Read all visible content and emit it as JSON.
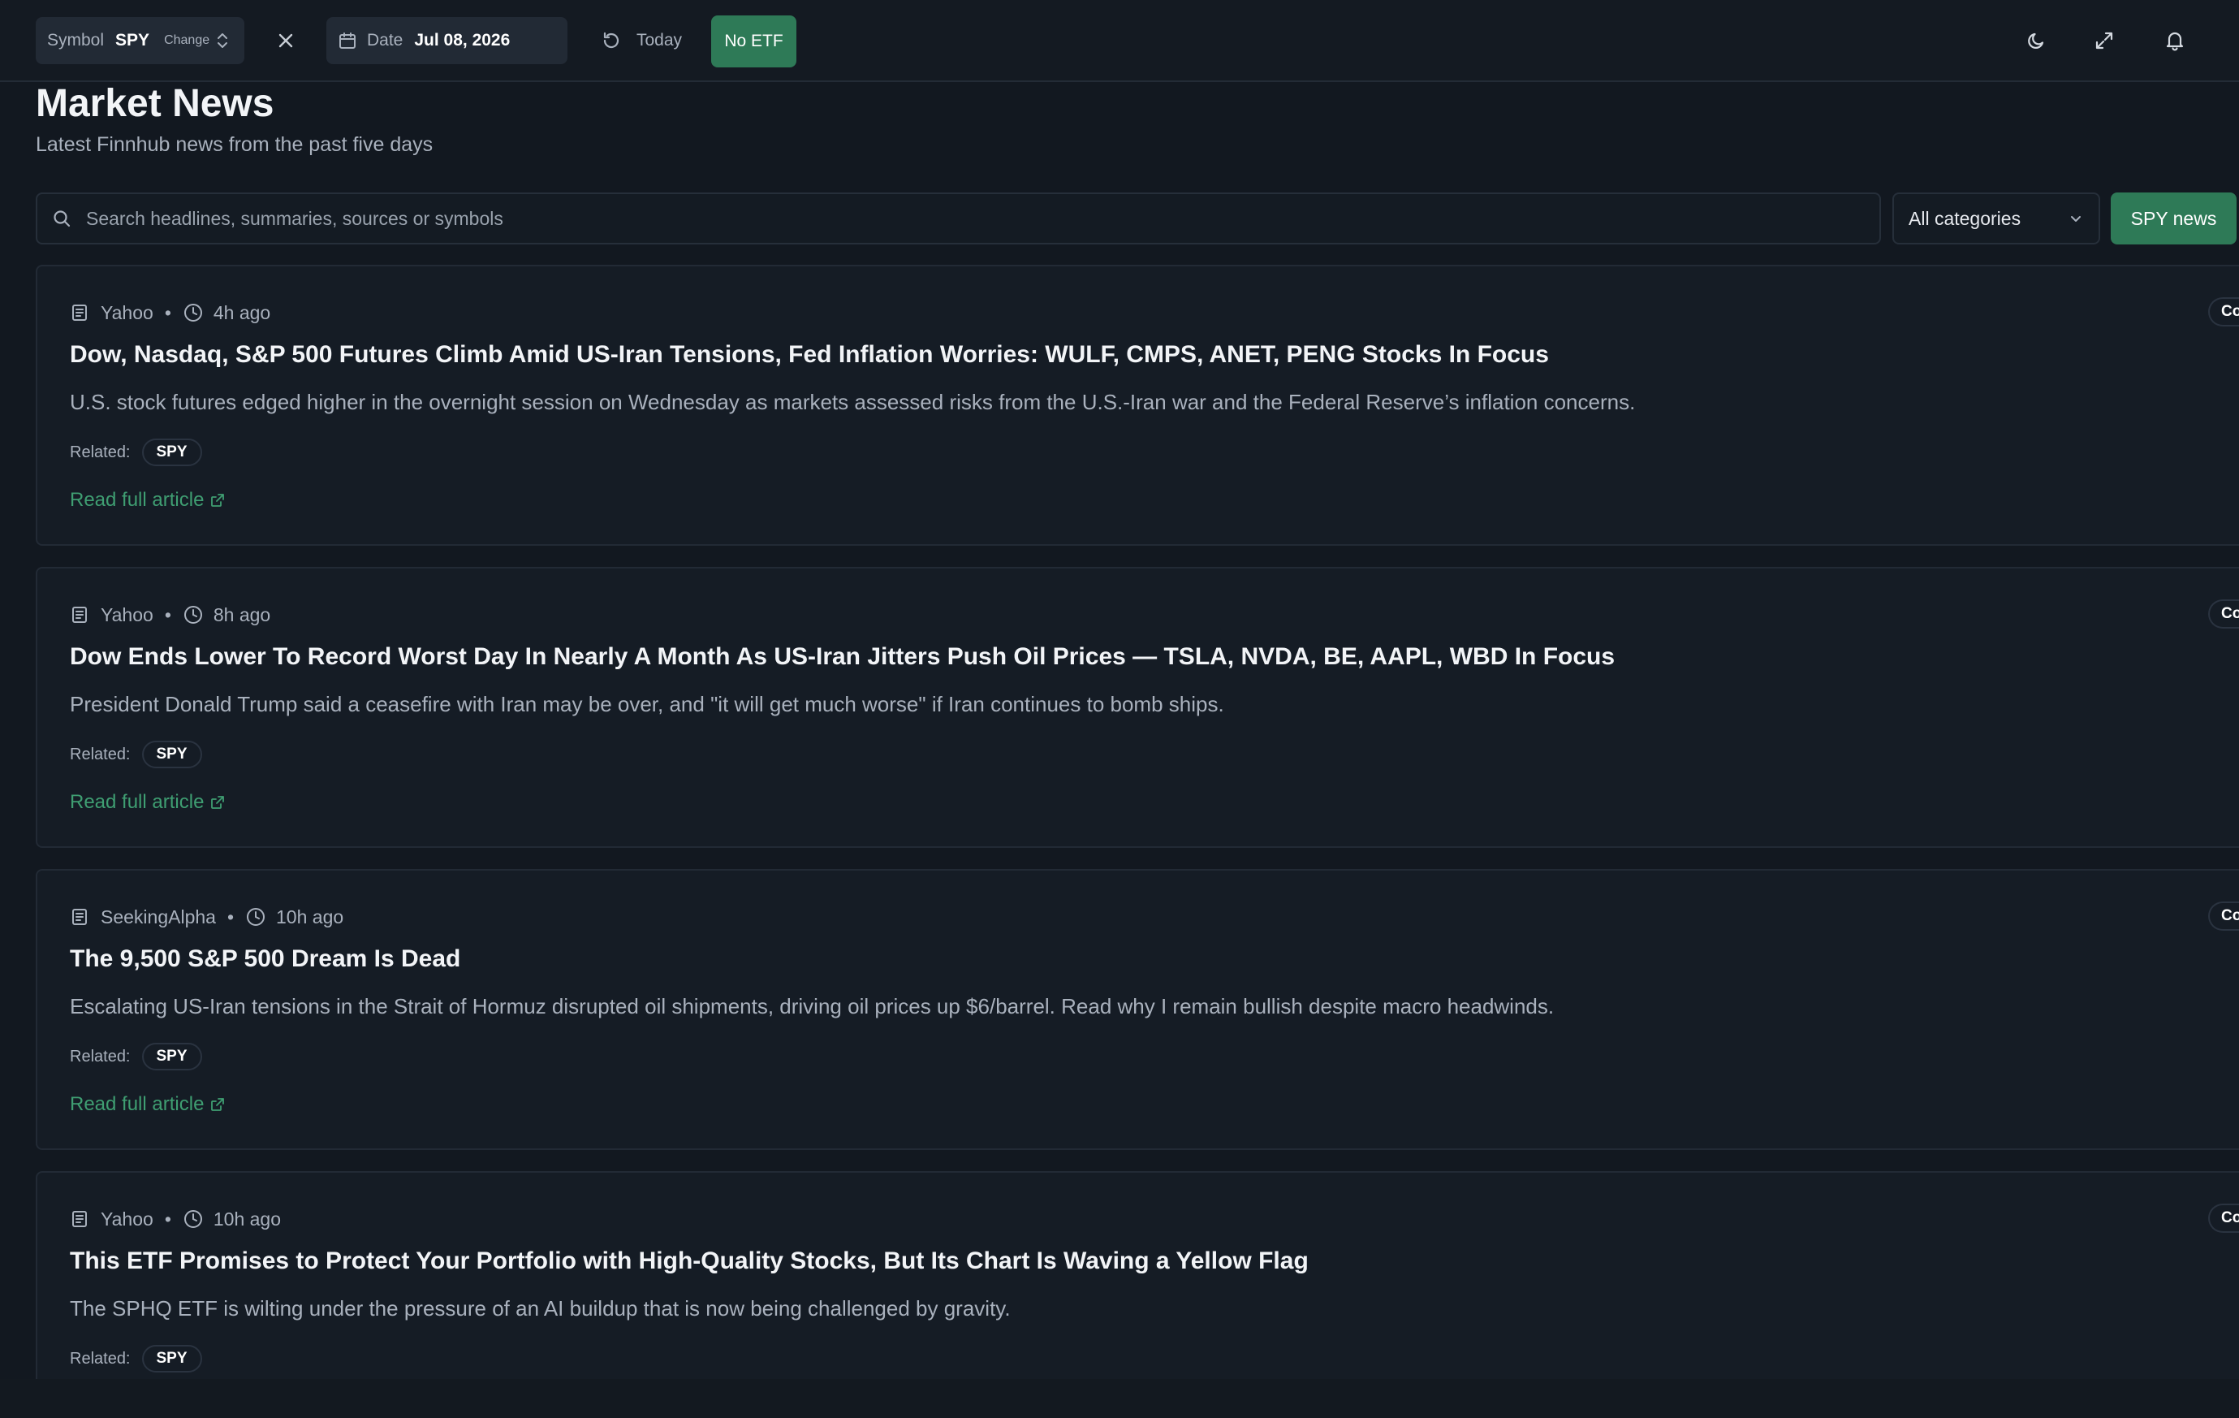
{
  "topbar": {
    "symbol_label": "Symbol",
    "symbol_value": "SPY",
    "change_label": "Change",
    "date_label": "Date",
    "date_value": "Jul 08, 2026",
    "today_label": "Today",
    "no_etf_label": "No ETF"
  },
  "header": {
    "title": "Market News",
    "subtitle": "Latest Finnhub news from the past five days"
  },
  "toolbar": {
    "search_placeholder": "Search headlines, summaries, sources or symbols",
    "category_selected": "All categories",
    "spy_news_label": "SPY news"
  },
  "labels": {
    "related": "Related:",
    "read_full": "Read full article",
    "meta_separator": "•"
  },
  "news": [
    {
      "source": "Yahoo",
      "time": "4h ago",
      "headline": "Dow, Nasdaq, S&P 500 Futures Climb Amid US-Iran Tensions, Fed Inflation Worries: WULF, CMPS, ANET, PENG Stocks In Focus",
      "summary": "U.S. stock futures edged higher in the overnight session on Wednesday as markets assessed risks from the U.S.-Iran war and the Federal Reserve’s inflation concerns.",
      "related": "SPY",
      "category_badge": "Co"
    },
    {
      "source": "Yahoo",
      "time": "8h ago",
      "headline": "Dow Ends Lower To Record Worst Day In Nearly A Month As US-Iran Jitters Push Oil Prices — TSLA, NVDA, BE, AAPL, WBD In Focus",
      "summary": "President Donald Trump said a ceasefire with Iran may be over, and \"it will get much worse\" if Iran continues to bomb ships.",
      "related": "SPY",
      "category_badge": "Co"
    },
    {
      "source": "SeekingAlpha",
      "time": "10h ago",
      "headline": "The 9,500 S&P 500 Dream Is Dead",
      "summary": "Escalating US-Iran tensions in the Strait of Hormuz disrupted oil shipments, driving oil prices up $6/barrel. Read why I remain bullish despite macro headwinds.",
      "related": "SPY",
      "category_badge": "Co"
    },
    {
      "source": "Yahoo",
      "time": "10h ago",
      "headline": "This ETF Promises to Protect Your Portfolio with High-Quality Stocks, But Its Chart Is Waving a Yellow Flag",
      "summary": "The SPHQ ETF is wilting under the pressure of an AI buildup that is now being challenged by gravity.",
      "related": "SPY",
      "category_badge": "Co"
    }
  ],
  "colors": {
    "background": "#121820",
    "accent": "#2e7a57",
    "link": "#3f9e72"
  },
  "icons": [
    "chevron-up-down-icon",
    "close-icon",
    "calendar-icon",
    "refresh-icon",
    "moon-icon",
    "expand-icon",
    "bell-icon",
    "search-icon",
    "chevron-down-icon",
    "newspaper-icon",
    "clock-icon",
    "external-link-icon"
  ]
}
